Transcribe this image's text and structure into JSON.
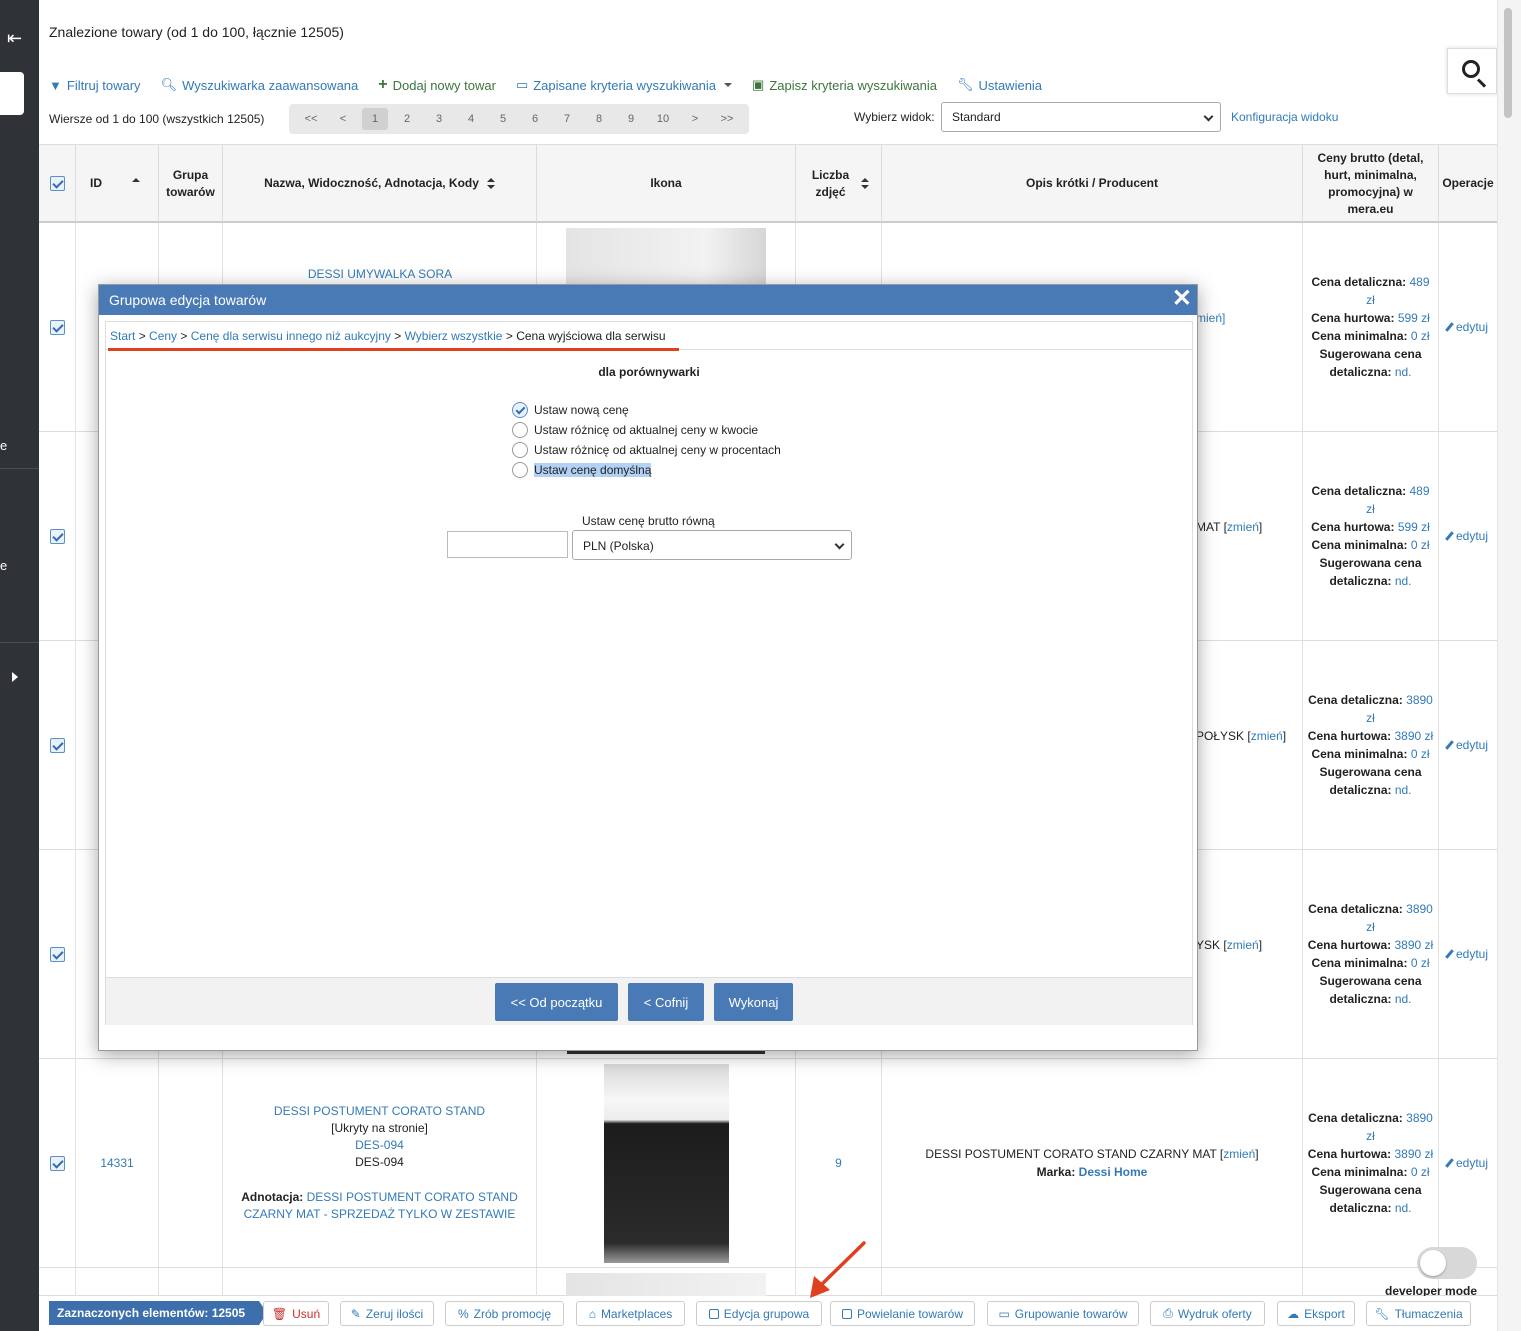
{
  "sidebar": {
    "fragment_a": "e",
    "fragment_b": "e"
  },
  "header": {
    "title": "Znalezione towary (od 1 do 100, łącznie 12505)"
  },
  "toolbar": {
    "filter": "Filtruj towary",
    "advanced": "Wyszukiwarka zaawansowana",
    "add": "Dodaj nowy towar",
    "saved": "Zapisane kryteria wyszukiwania",
    "save": "Zapisz kryteria wyszukiwania",
    "settings": "Ustawienia"
  },
  "rows_info": "Wiersze od 1 do 100 (wszystkich 12505)",
  "pager": {
    "first": "<<",
    "prev": "<",
    "pages": [
      "1",
      "2",
      "3",
      "4",
      "5",
      "6",
      "7",
      "8",
      "9",
      "10"
    ],
    "next": ">",
    "last": ">>",
    "current": "1"
  },
  "view": {
    "label": "Wybierz widok:",
    "selected": "Standard",
    "config": "Konfiguracja widoku"
  },
  "table": {
    "headers": {
      "id": "ID",
      "group": "Grupa towarów",
      "name": "Nazwa, Widoczność, Adnotacja, Kody",
      "icon": "Ikona",
      "photos": "Liczba zdjęć",
      "desc": "Opis krótki / Producent",
      "prices": "Ceny brutto (detal, hurt, minimalna, promocyjna) w mera.eu",
      "ops": "Operacje"
    },
    "rows": [
      {
        "name_link": "DESSI UMYWALKA SORA",
        "desc_tail": "mień]",
        "retail": "489",
        "retail_unit": "zł",
        "wholesale": "599 zł",
        "minimum": "0 zł",
        "suggested": "nd."
      },
      {
        "desc_tail": "MAT",
        "desc_link": "zmień",
        "retail": "489",
        "retail_unit": "zł",
        "wholesale": "599 zł",
        "minimum": "0 zł",
        "suggested": "nd."
      },
      {
        "desc_tail": "POŁYSK",
        "desc_link": "zmień",
        "retail": "3890",
        "retail_unit": "zł",
        "wholesale": "3890 zł",
        "minimum": "0 zł",
        "suggested": "nd."
      },
      {
        "desc_tail": "YSK",
        "desc_link": "zmień",
        "retail": "3890",
        "retail_unit": "zł",
        "wholesale": "3890 zł",
        "minimum": "0 zł",
        "suggested": "nd."
      },
      {
        "id": "14331",
        "name_link": "DESSI POSTUMENT CORATO STAND",
        "visibility": "[Ukryty na stronie]",
        "code_link": "DES-094",
        "code": "DES-094",
        "annotation_label": "Adnotacja:",
        "annotation_link": "DESSI POSTUMENT CORATO STAND CZARNY MAT - SPRZEDAŻ TYLKO W ZESTAWIE",
        "photos": "9",
        "desc_text": "DESSI POSTUMENT CORATO STAND CZARNY MAT",
        "desc_link": "zmień",
        "brand_label": "Marka:",
        "brand": "Dessi Home",
        "retail": "3890",
        "retail_unit": "zł",
        "wholesale": "3890 zł",
        "minimum": "0 zł",
        "suggested": "nd."
      }
    ],
    "price_labels": {
      "retail": "Cena detaliczna:",
      "wholesale": "Cena hurtowa:",
      "minimum": "Cena minimalna:",
      "suggested_1": "Sugerowana cena",
      "suggested_2": "detaliczna:"
    },
    "edit": "edytuj"
  },
  "modal": {
    "title": "Grupowa edycja towarów",
    "close": "✕",
    "breadcrumb": {
      "start": "Start",
      "prices": "Ceny",
      "other_service": "Cenę dla serwisu innego niż aukcyjny",
      "select_all": "Wybierz wszystkie",
      "current": "Cena wyjściowa dla serwisu",
      "sep": ">"
    },
    "subtitle": "dla porównywarki",
    "options": [
      {
        "label": "Ustaw nową cenę",
        "checked": true
      },
      {
        "label": "Ustaw różnicę od aktualnej ceny w kwocie",
        "checked": false
      },
      {
        "label": "Ustaw różnicę od aktualnej ceny w procentach",
        "checked": false
      },
      {
        "label": "Ustaw cenę domyślną",
        "checked": false
      }
    ],
    "price_label": "Ustaw cenę brutto równą",
    "price_value": "",
    "currency": "PLN (Polska)",
    "buttons": {
      "restart": "<< Od początku",
      "back": "< Cofnij",
      "execute": "Wykonaj"
    }
  },
  "bottom": {
    "selected": "Zaznaczonych elementów: 12505",
    "delete": "Usuń",
    "zero": "Zeruj ilości",
    "promo": "Zrób promocję",
    "marketplaces": "Marketplaces",
    "group_edit": "Edycja grupowa",
    "duplicate": "Powielanie towarów",
    "grouping": "Grupowanie towarów",
    "print": "Wydruk oferty",
    "export": "Eksport",
    "translations": "Tłumaczenia"
  },
  "developer_mode": {
    "label": "developer mode",
    "enabled": false
  },
  "colors": {
    "accent": "#4a7ab5",
    "link": "#337ab7",
    "danger": "#c9302c",
    "annotation_arrow": "#e0401e",
    "sidebar": "#2f3237"
  }
}
